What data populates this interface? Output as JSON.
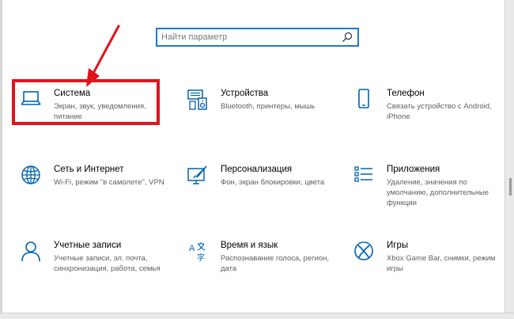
{
  "search": {
    "placeholder": "Найти параметр"
  },
  "tiles": [
    {
      "title": "Система",
      "desc": "Экран, звук, уведомления, питание",
      "icon": "laptop-icon"
    },
    {
      "title": "Устройства",
      "desc": "Bluetooth, принтеры, мышь",
      "icon": "devices-icon"
    },
    {
      "title": "Телефон",
      "desc": "Связать устройство с Android, iPhone",
      "icon": "phone-icon"
    },
    {
      "title": "Сеть и Интернет",
      "desc": "Wi-Fi, режим \"в самолете\", VPN",
      "icon": "globe-icon"
    },
    {
      "title": "Персонализация",
      "desc": "Фон, экран блокировки, цвета",
      "icon": "personalization-icon"
    },
    {
      "title": "Приложения",
      "desc": "Удаление, значения по умолчанию, дополнительные функции",
      "icon": "apps-list-icon"
    },
    {
      "title": "Учетные записи",
      "desc": "Учетные записи, эл. почта, синхронизация, работа, семья",
      "icon": "person-icon"
    },
    {
      "title": "Время и язык",
      "desc": "Распознавание голоса, регион, дата",
      "icon": "time-language-icon"
    },
    {
      "title": "Игры",
      "desc": "Xbox Game Bar, снимки, режим игры",
      "icon": "xbox-icon"
    }
  ],
  "colors": {
    "accent": "#0063b1",
    "highlight": "#e0141c",
    "search_border": "#1e78d6"
  }
}
